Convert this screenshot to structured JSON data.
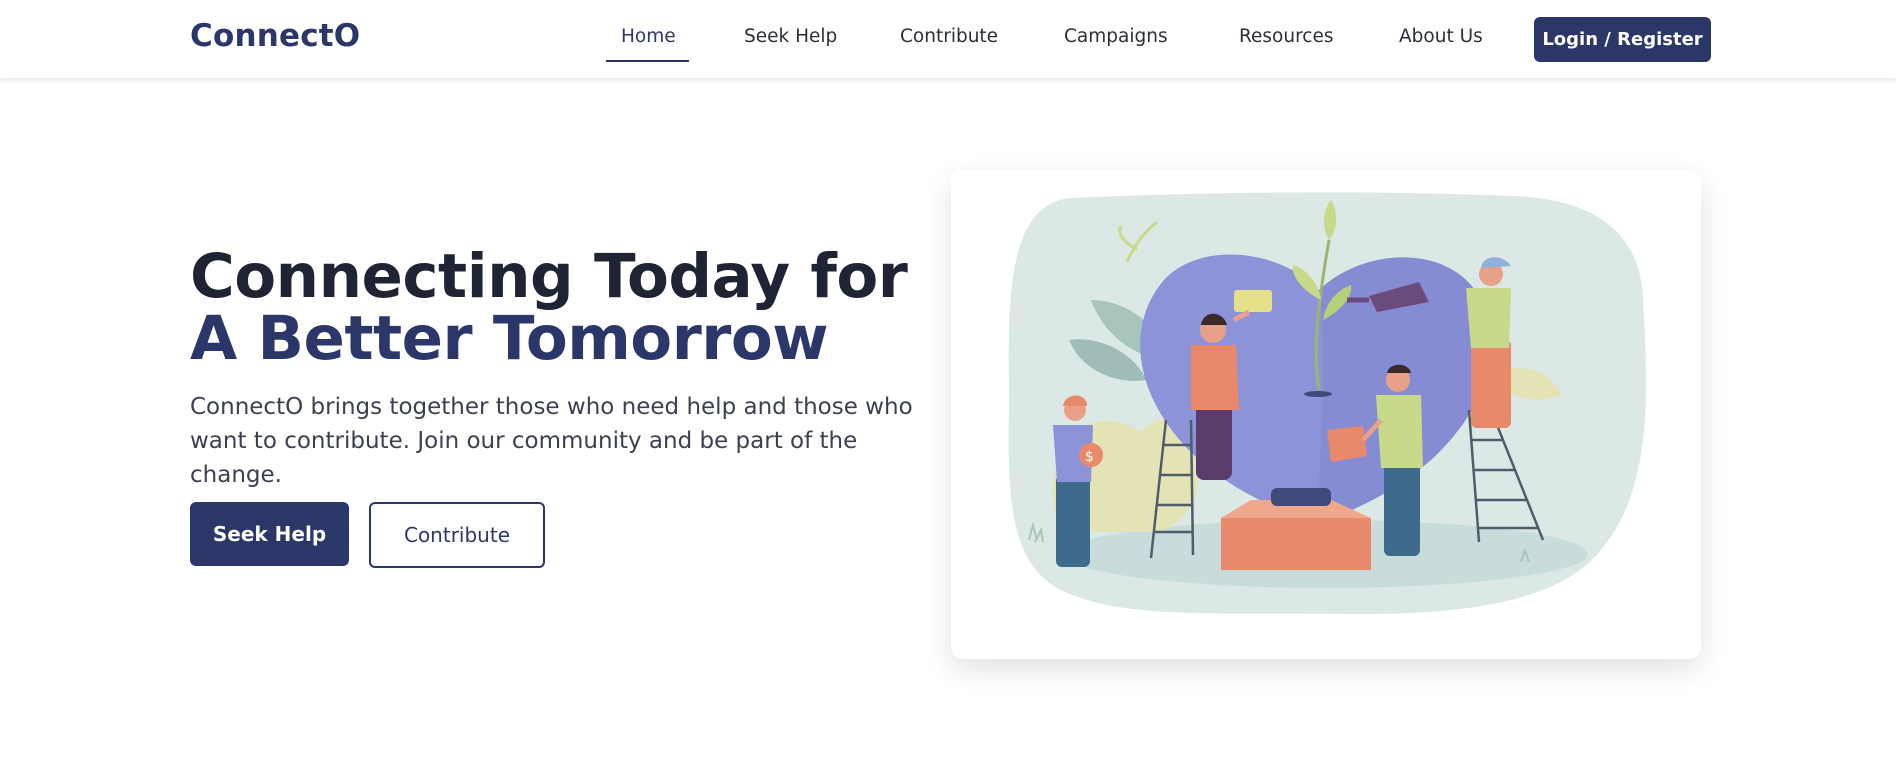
{
  "brand": {
    "name": "ConnectO"
  },
  "nav": {
    "items": [
      {
        "label": "Home",
        "active": true
      },
      {
        "label": "Seek Help",
        "active": false
      },
      {
        "label": "Contribute",
        "active": false
      },
      {
        "label": "Campaigns",
        "active": false
      },
      {
        "label": "Resources",
        "active": false
      },
      {
        "label": "About Us",
        "active": false
      }
    ],
    "login_label": "Login / Register"
  },
  "hero": {
    "title_line1": "Connecting Today for",
    "title_line2": "A Better Tomorrow",
    "description": "ConnectO brings together those who need help and those who want to contribute. Join our community and be part of the change.",
    "primary_button": "Seek Help",
    "secondary_button": "Contribute"
  },
  "colors": {
    "brand_navy": "#2b3769",
    "heading_dark": "#1e2433",
    "blob_bg": "#dce8e6",
    "heart": "#8c93d8"
  }
}
